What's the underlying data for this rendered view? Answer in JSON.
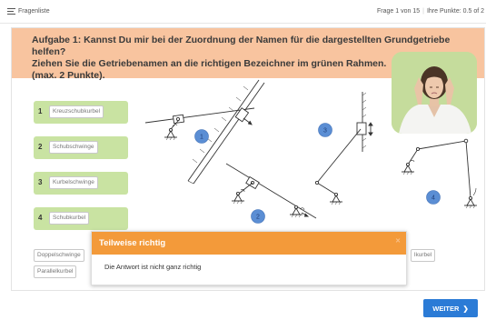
{
  "topbar": {
    "menu_label": "Fragenliste",
    "question_counter": "Frage 1 von 15",
    "points": "Ihre Punkte: 0.5 of 2"
  },
  "question": {
    "line1": "Aufgabe 1:  Kannst Du mir bei der Zuordnung der Namen für die dargestellten Grundgetriebe helfen?",
    "line2": "Ziehen Sie die Getriebenamen an die richtigen Bezeichner im grünen Rahmen.",
    "line3": "(max. 2 Punkte)."
  },
  "answers": [
    {
      "number": "1",
      "value": "Kreuzschubkurbel"
    },
    {
      "number": "2",
      "value": "Schubschwinge"
    },
    {
      "number": "3",
      "value": "Kurbelschwinge"
    },
    {
      "number": "4",
      "value": "Schubkurbel"
    }
  ],
  "diagram_labels": [
    "1",
    "2",
    "3",
    "4"
  ],
  "pool": {
    "chip1": "Doppelschwinge",
    "chip2": "Parallelkurbel",
    "chip_right": "lkurbel"
  },
  "dialog": {
    "title": "Teilweise richtig",
    "message": "Die Antwort ist nicht ganz richtig"
  },
  "footer": {
    "next_label": "WEITER",
    "next_icon": "chevron-right-icon"
  },
  "colors": {
    "question_bg": "#f8c49f",
    "answer_bg": "#c9e3a2",
    "dialog_header": "#f39a3a",
    "primary_button": "#2b7bd6",
    "badge": "#5b8ed4"
  }
}
